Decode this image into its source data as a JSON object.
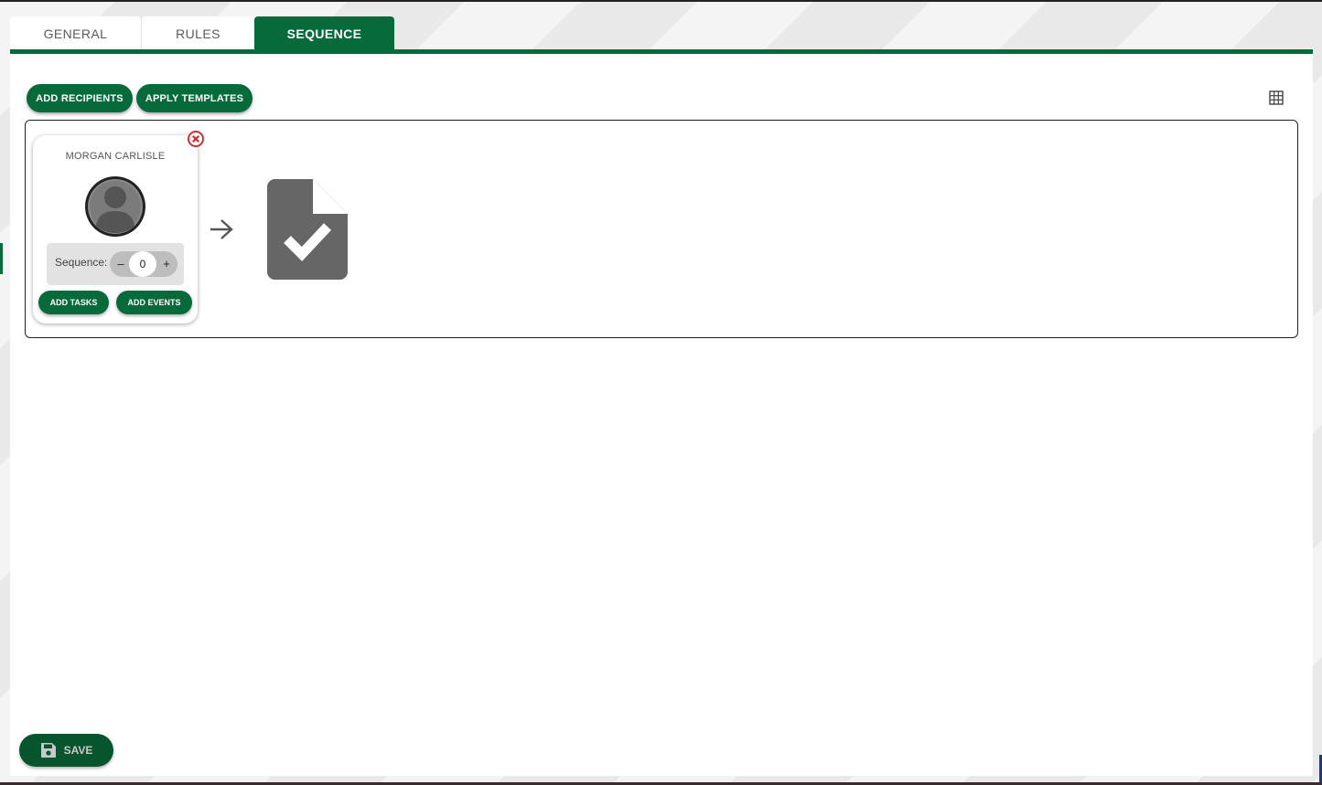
{
  "tabs": [
    {
      "label": "GENERAL"
    },
    {
      "label": "RULES"
    },
    {
      "label": "SEQUENCE"
    }
  ],
  "toolbar": {
    "add_recipients_label": "ADD RECIPIENTS",
    "apply_templates_label": "APPLY TEMPLATES"
  },
  "recipient_card": {
    "name": "MORGAN CARLISLE",
    "sequence_label": "Sequence:",
    "sequence_value": "0",
    "minus_label": "–",
    "plus_label": "+",
    "add_tasks_label": "ADD TASKS",
    "add_events_label": "ADD EVENTS"
  },
  "footer": {
    "save_label": "SAVE"
  },
  "icons": {
    "grid": "grid-icon",
    "remove": "remove-circle-icon",
    "arrow": "arrow-right-icon",
    "document": "document-check-icon",
    "avatar": "person-avatar-icon",
    "save": "floppy-disk-icon"
  },
  "colors": {
    "primary": "#066a3b",
    "save_button": "#07552f",
    "remove": "#d32f2f",
    "document": "#666666"
  }
}
